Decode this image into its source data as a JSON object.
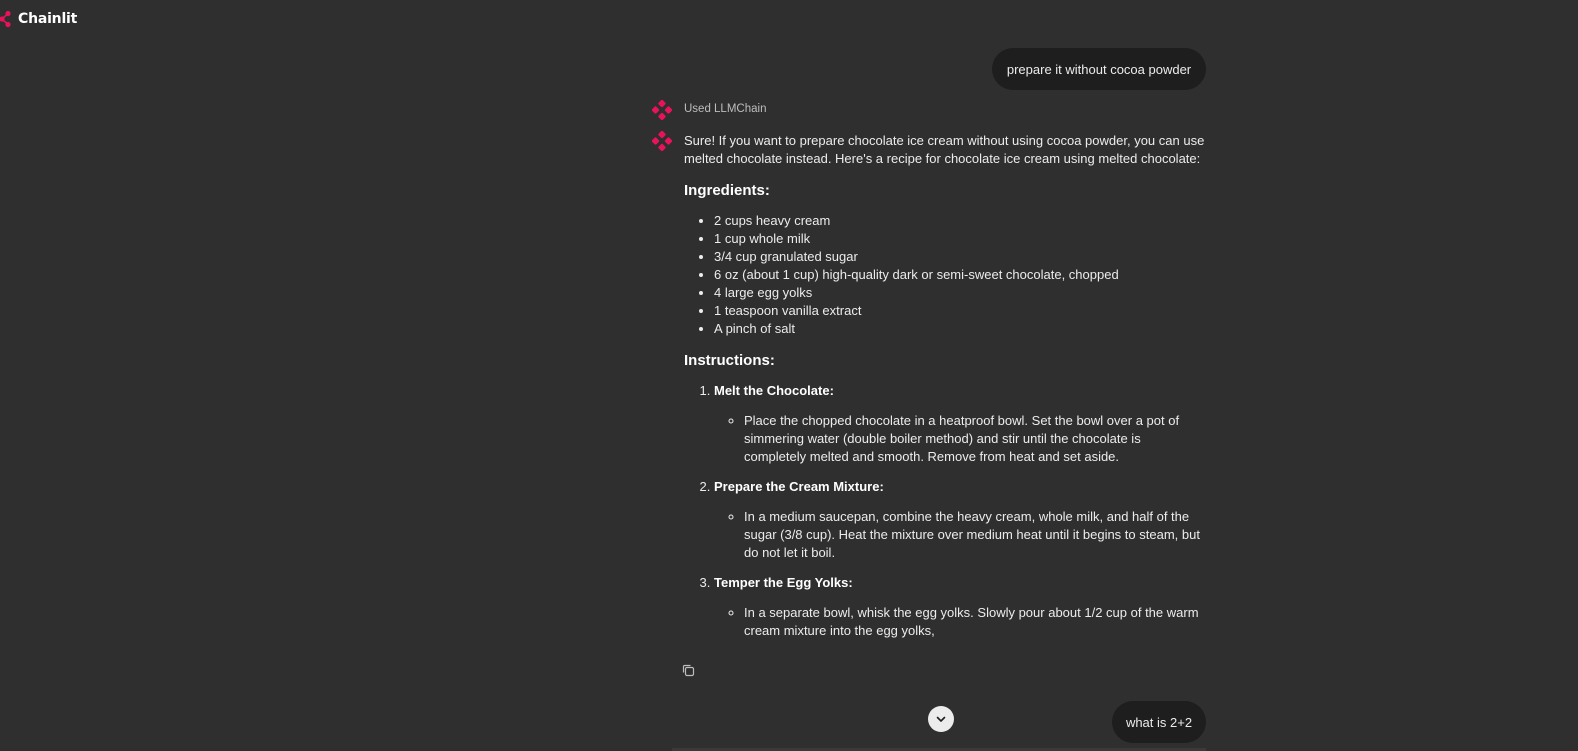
{
  "app": {
    "name": "Chainlit",
    "brand_color": "#e8125d"
  },
  "conversation": {
    "user_message_1": "prepare it without cocoa powder",
    "step_label": "Used LLMChain",
    "assistant": {
      "intro": "Sure! If you want to prepare chocolate ice cream without using cocoa powder, you can use melted chocolate instead. Here's a recipe for chocolate ice cream using melted chocolate:",
      "ingredients_heading": "Ingredients:",
      "ingredients": [
        "2 cups heavy cream",
        "1 cup whole milk",
        "3/4 cup granulated sugar",
        "6 oz (about 1 cup) high-quality dark or semi-sweet chocolate, chopped",
        "4 large egg yolks",
        "1 teaspoon vanilla extract",
        "A pinch of salt"
      ],
      "instructions_heading": "Instructions:",
      "steps": [
        {
          "title": "Melt the Chocolate:",
          "detail": "Place the chopped chocolate in a heatproof bowl. Set the bowl over a pot of simmering water (double boiler method) and stir until the chocolate is completely melted and smooth. Remove from heat and set aside."
        },
        {
          "title": "Prepare the Cream Mixture:",
          "detail": "In a medium saucepan, combine the heavy cream, whole milk, and half of the sugar (3/8 cup). Heat the mixture over medium heat until it begins to steam, but do not let it boil."
        },
        {
          "title": "Temper the Egg Yolks:",
          "detail": "In a separate bowl, whisk the egg yolks. Slowly pour about 1/2 cup of the warm cream mixture into the egg yolks,"
        }
      ]
    },
    "user_message_2": "what is 2+2"
  },
  "icons": {
    "logo": "chainlit-logo-icon",
    "avatar": "assistant-avatar-icon",
    "copy": "copy-icon",
    "scroll": "chevron-down-icon"
  }
}
